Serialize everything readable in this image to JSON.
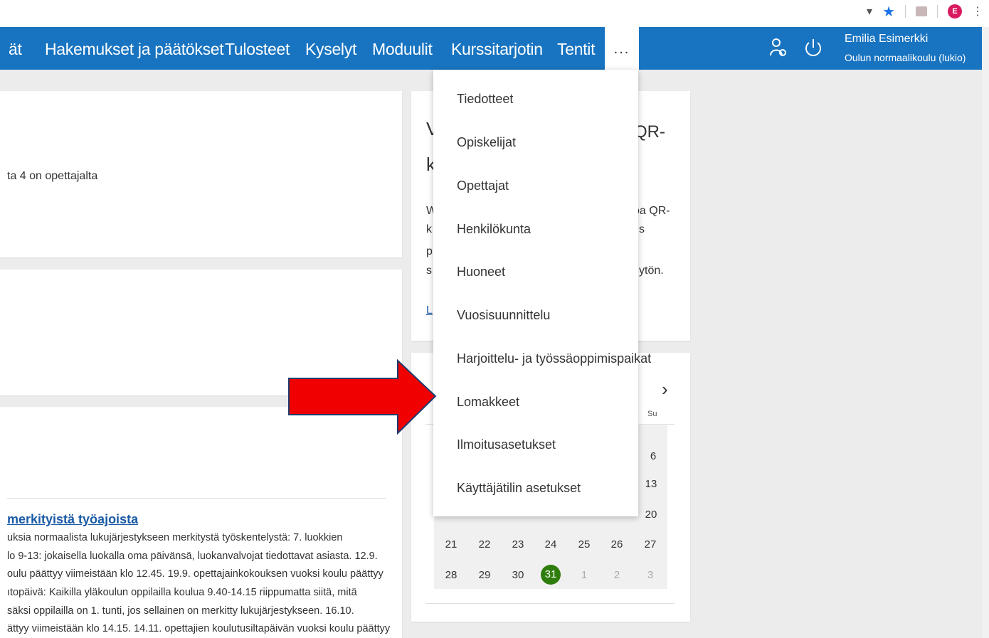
{
  "nav": {
    "items": [
      "ät",
      "Hakemukset ja päätökset",
      "Tulosteet",
      "Kyselyt",
      "Moduulit",
      "Kurssitarjotin",
      "Tentit"
    ],
    "more_label": "...",
    "user_name": "Emilia Esimerkki",
    "user_school": "Oulun normaalikoulu (lukio)"
  },
  "chrome": {
    "profile_letter": "E"
  },
  "dropdown": {
    "items": [
      "Tiedotteet",
      "Opiskelijat",
      "Opettajat",
      "Henkilökunta",
      "Huoneet",
      "Vuosisuunnittelu",
      "Harjoittelu- ja työssäoppimispaikat",
      "Lomakkeet",
      "Ilmoitusasetukset",
      "Käyttäjätilin asetukset"
    ]
  },
  "left_card": {
    "text": "ta 4 on opettajalta"
  },
  "qr_card": {
    "title_start": "V",
    "title_end": "QR-",
    "title_line2": "k",
    "body_line1_start": "W",
    "body_line1_end": "oa QR-",
    "body_line2_start": "k",
    "body_line2_end": "s",
    "body_line3_start": "p",
    "body_line4_start": "s",
    "body_line4_end": "ytön.",
    "link_start": "L"
  },
  "calendar": {
    "next_arrow": "›",
    "weekday_sun": "Su",
    "rows": [
      [
        "",
        "",
        "",
        "",
        "",
        "",
        "6"
      ],
      [
        "",
        "",
        "",
        "",
        "",
        "",
        "13"
      ],
      [
        "",
        "",
        "",
        "",
        "",
        "",
        "20"
      ],
      [
        "21",
        "22",
        "23",
        "24",
        "25",
        "26",
        "27"
      ],
      [
        "28",
        "29",
        "30",
        "31",
        "1",
        "2",
        "3"
      ]
    ],
    "today": "31"
  },
  "news": {
    "title": "merkityistä työajoista",
    "lines": [
      "uksia normaalista lukujärjestykseen merkitystä työskentelystä: 7. luokkien",
      "lo 9-13: jokaisella luokalla oma päivänsä, luokanvalvojat tiedottavat asiasta. 12.9.",
      "oulu päättyy viimeistään klo 12.45. 19.9. opettajainkokouksen vuoksi koulu päättyy",
      "ıtopäivä: Kaikilla yläkoulun oppilailla koulua 9.40-14.15 riippumatta siitä, mitä",
      "säksi oppilailla on 1. tunti, jos sellainen on merkitty lukujärjestykseen. 16.10.",
      "ättyy viimeistään klo 14.15. 14.11. opettajien koulutusiltapäivän vuoksi koulu päättyy"
    ]
  },
  "colors": {
    "nav": "#1874c1",
    "arrow": "#f00000",
    "today": "#2e7d0c",
    "link": "#1a5aa6"
  }
}
